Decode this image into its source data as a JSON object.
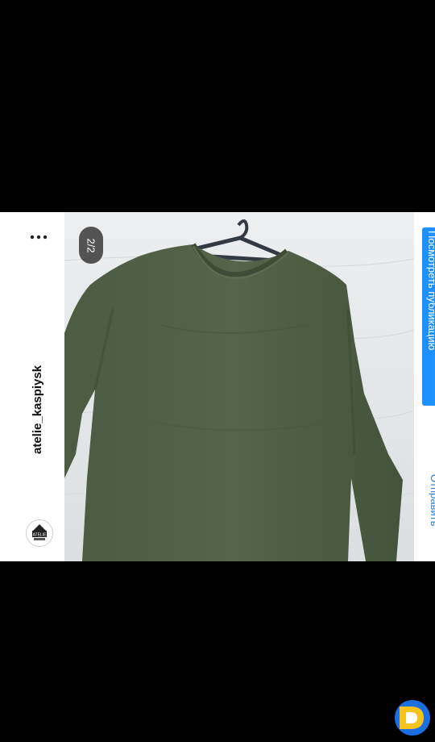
{
  "post": {
    "username": "atelie_kaspiysk",
    "avatar_text": "ATELIE",
    "counter": "2/2",
    "view_button_label": "Посмотреть публикацию",
    "comments_label": "Отправить"
  },
  "icons": {
    "more": "more-dots-icon",
    "logo": "brand-logo-icon"
  },
  "colors": {
    "garment": "#4a5a40",
    "accent": "#1e90ff",
    "logo_yellow": "#f7c21b",
    "logo_blue": "#1b6fe0"
  }
}
